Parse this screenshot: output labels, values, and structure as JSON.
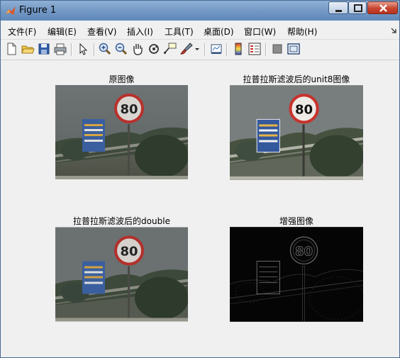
{
  "window": {
    "title": "Figure 1"
  },
  "menu": [
    "文件(F)",
    "编辑(E)",
    "查看(V)",
    "插入(I)",
    "工具(T)",
    "桌面(D)",
    "窗口(W)",
    "帮助(H)"
  ],
  "toolbar": {
    "buttons": [
      "new-figure",
      "open-file",
      "save-figure",
      "print-figure",
      "edit-plot",
      "zoom-in",
      "zoom-out",
      "pan",
      "rotate-3d",
      "data-cursor",
      "brush",
      "link-plot",
      "colorbar",
      "legend",
      "hide-plot-tools",
      "show-plot-tools"
    ]
  },
  "axes": [
    {
      "title": "原图像",
      "variant": "original"
    },
    {
      "title": "拉普拉斯滤波后的unit8图像",
      "variant": "unit8"
    },
    {
      "title": "拉普拉斯滤波后的double",
      "variant": "double"
    },
    {
      "title": "增强图像",
      "variant": "enhanced"
    }
  ],
  "sign_text": "80",
  "colors": {
    "title_gradient_top": "#8fb0d6",
    "figure_bg": "#f0f0f0",
    "sign_ring": "#c8322c",
    "blue_board": "#3b5f9e",
    "enhanced_bg": "#050505"
  }
}
